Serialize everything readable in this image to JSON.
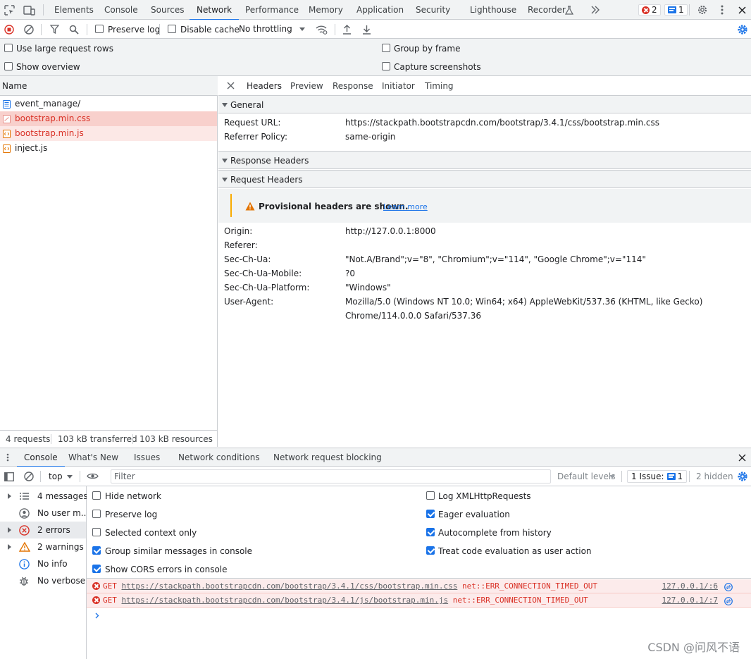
{
  "top_tabs": [
    "Elements",
    "Console",
    "Sources",
    "Network",
    "Performance",
    "Memory",
    "Application",
    "Security",
    "Lighthouse",
    "Recorder"
  ],
  "active_top_tab": "Network",
  "badges": {
    "errors": "2",
    "issues": "1"
  },
  "net_toolbar": {
    "preserve_log": "Preserve log",
    "disable_cache": "Disable cache",
    "throttling": "No throttling"
  },
  "net_settings": {
    "large_rows": "Use large request rows",
    "show_overview": "Show overview",
    "group_by_frame": "Group by frame",
    "capture_screenshots": "Capture screenshots"
  },
  "request_list": {
    "header": "Name",
    "items": [
      "event_manage/",
      "bootstrap.min.css",
      "bootstrap.min.js",
      "inject.js"
    ],
    "summary": {
      "requests": "4 requests",
      "transferred": "103 kB transferred",
      "resources": "103 kB resources"
    }
  },
  "detail_tabs": [
    "Headers",
    "Preview",
    "Response",
    "Initiator",
    "Timing"
  ],
  "general": {
    "title": "General",
    "rows": [
      {
        "key": "Request URL:",
        "value": "https://stackpath.bootstrapcdn.com/bootstrap/3.4.1/css/bootstrap.min.css"
      },
      {
        "key": "Referrer Policy:",
        "value": "same-origin"
      }
    ]
  },
  "response_headers_title": "Response Headers",
  "request_headers": {
    "title": "Request Headers",
    "provisional": "Provisional headers are shown.",
    "learn_more": "Learn more",
    "rows": [
      {
        "key": "Origin:",
        "value": "http://127.0.0.1:8000"
      },
      {
        "key": "Referer:",
        "value": ""
      },
      {
        "key": "Sec-Ch-Ua:",
        "value": "\"Not.A/Brand\";v=\"8\", \"Chromium\";v=\"114\", \"Google Chrome\";v=\"114\""
      },
      {
        "key": "Sec-Ch-Ua-Mobile:",
        "value": "?0"
      },
      {
        "key": "Sec-Ch-Ua-Platform:",
        "value": "\"Windows\""
      },
      {
        "key": "User-Agent:",
        "value": "Mozilla/5.0 (Windows NT 10.0; Win64; x64) AppleWebKit/537.36 (KHTML, like Gecko) Chrome/114.0.0.0 Safari/537.36"
      }
    ]
  },
  "drawer_tabs": [
    "Console",
    "What's New",
    "Issues",
    "Network conditions",
    "Network request blocking"
  ],
  "console_toolbar": {
    "context": "top",
    "filter_placeholder": "Filter",
    "default_levels": "Default levels",
    "issue_label": "1 Issue:",
    "issue_count": "1",
    "hidden": "2 hidden"
  },
  "console_sidebar": [
    "4 messages",
    "No user m...",
    "2 errors",
    "2 warnings",
    "No info",
    "No verbose"
  ],
  "console_settings": {
    "left": [
      {
        "label": "Hide network",
        "checked": false
      },
      {
        "label": "Preserve log",
        "checked": false
      },
      {
        "label": "Selected context only",
        "checked": false
      },
      {
        "label": "Group similar messages in console",
        "checked": true
      },
      {
        "label": "Show CORS errors in console",
        "checked": true
      }
    ],
    "right": [
      {
        "label": "Log XMLHttpRequests",
        "checked": false
      },
      {
        "label": "Eager evaluation",
        "checked": true
      },
      {
        "label": "Autocomplete from history",
        "checked": true
      },
      {
        "label": "Treat code evaluation as user action",
        "checked": true
      }
    ]
  },
  "console_logs": [
    {
      "method": "GET",
      "url": "https://stackpath.bootstrapcdn.com/bootstrap/3.4.1/css/bootstrap.min.css",
      "error": "net::ERR_CONNECTION_TIMED_OUT",
      "source": "127.0.0.1/:6"
    },
    {
      "method": "GET",
      "url": "https://stackpath.bootstrapcdn.com/bootstrap/3.4.1/js/bootstrap.min.js",
      "error": "net::ERR_CONNECTION_TIMED_OUT",
      "source": "127.0.0.1/:7"
    }
  ],
  "watermark": "CSDN @问风不语",
  "colors": {
    "accent": "#1a73e8",
    "error": "#d93025",
    "warning": "#f9ab00"
  }
}
